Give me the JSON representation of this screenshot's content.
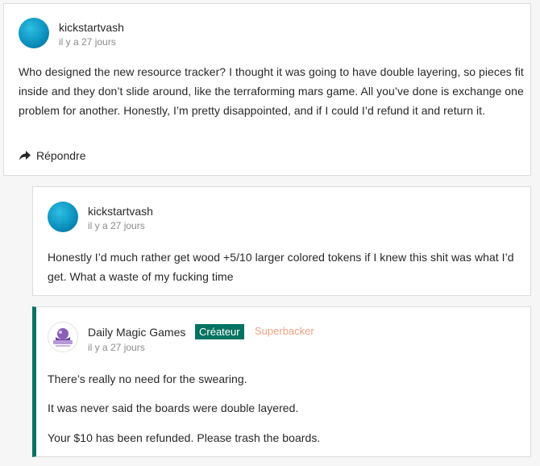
{
  "comments": [
    {
      "username": "kickstartvash",
      "time": "il y a 27 jours",
      "body": [
        "Who designed the new resource tracker? I thought it was going to have double layering, so pieces fit inside and they don’t slide around, like the terraforming mars game. All you’ve done is exchange one problem for another. Honestly, I’m pretty disappointed, and if I could I’d refund it and return it."
      ],
      "reply_label": "Répondre"
    }
  ],
  "replies": [
    {
      "username": "kickstartvash",
      "time": "il y a 27 jours",
      "body": [
        "Honestly I’d much rather get wood +5/10 larger colored tokens if I knew this shit was what I’d get. What a waste of my fucking time"
      ]
    },
    {
      "username": "Daily Magic Games",
      "time": "il y a 27 jours",
      "badge_creator": "Créateur",
      "badge_superbacker": "Superbacker",
      "body": [
        "There’s really no need for the swearing.",
        "It was never said the boards were double layered.",
        "Your $10 has been refunded. Please trash the boards."
      ]
    }
  ],
  "colors": {
    "creator_badge": "#037362",
    "superbacker": "#f0a283",
    "creator_accent_border": "#037362"
  },
  "icons": {
    "reply": "reply-arrow-icon",
    "avatar_user": "blue-grid-avatar",
    "avatar_creator": "daily-magic-games-logo"
  }
}
